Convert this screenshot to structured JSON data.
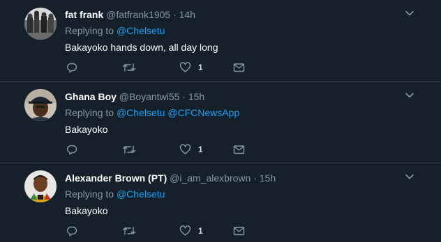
{
  "tweets": [
    {
      "name": "fat frank",
      "handle": "@fatfrank1905",
      "separator": "·",
      "time": "14h",
      "replying_prefix": "Replying to",
      "mentions": [
        "@Chelsetu"
      ],
      "text": "Bakayoko hands down, all day long",
      "like_count": "1",
      "avatar_icon": "profile-photo-grayscale"
    },
    {
      "name": "Ghana Boy",
      "handle": "@Boyantwi55",
      "separator": "·",
      "time": "15h",
      "replying_prefix": "Replying to",
      "mentions": [
        "@Chelsetu",
        "@CFCNewsApp"
      ],
      "text": "Bakayoko",
      "like_count": "1",
      "avatar_icon": "profile-photo-man-in-cap"
    },
    {
      "name": "Alexander Brown (PT)",
      "handle": "@i_am_alexbrown",
      "separator": "·",
      "time": "15h",
      "replying_prefix": "Replying to",
      "mentions": [
        "@Chelsetu"
      ],
      "text": "Bakayoko",
      "like_count": "1",
      "avatar_icon": "profile-photo-man-in-kente"
    }
  ],
  "colors": {
    "background": "#15202b",
    "divider": "#38444d",
    "secondary_text": "#8899a6",
    "link": "#1da1f2"
  }
}
